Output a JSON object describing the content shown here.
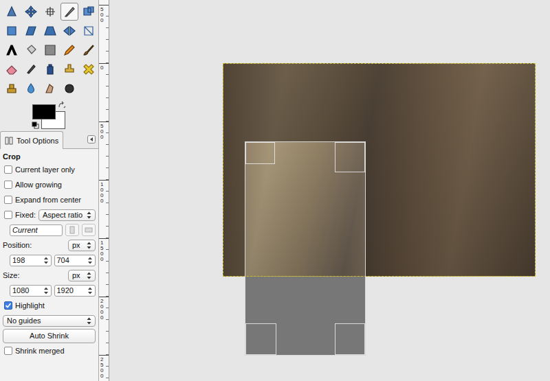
{
  "toolbox": {
    "tools": [
      {
        "selected": false
      },
      {
        "selected": false
      },
      {
        "selected": false
      },
      {
        "selected": true
      },
      {
        "selected": false
      },
      {
        "selected": false
      },
      {
        "selected": false
      },
      {
        "selected": false
      },
      {
        "selected": false
      },
      {
        "selected": false
      },
      {
        "selected": false
      },
      {
        "selected": false
      },
      {
        "selected": false
      },
      {
        "selected": false
      },
      {
        "selected": false
      },
      {
        "selected": false
      },
      {
        "selected": false
      },
      {
        "selected": false
      },
      {
        "selected": false
      },
      {
        "selected": false
      },
      {
        "selected": false
      },
      {
        "selected": false
      },
      {
        "selected": false
      },
      {
        "selected": false
      }
    ],
    "colors": {
      "foreground": "#000000",
      "background": "#ffffff"
    }
  },
  "tool_options": {
    "tab": "Tool Options",
    "title": "Crop",
    "checkboxes": [
      {
        "label": "Current layer only",
        "checked": false
      },
      {
        "label": "Allow growing",
        "checked": false
      },
      {
        "label": "Expand from center",
        "checked": false
      }
    ],
    "fixed": {
      "label": "Fixed:",
      "checked": false,
      "mode": "Aspect ratio",
      "value": "Current"
    },
    "position": {
      "label": "Position:",
      "unit": "px",
      "x": "198",
      "y": "704"
    },
    "size": {
      "label": "Size:",
      "unit": "px",
      "width": "1080",
      "height": "1920"
    },
    "highlight": {
      "label": "Highlight",
      "checked": true
    },
    "guides": "No guides",
    "auto_shrink": "Auto Shrink",
    "shrink_merged": {
      "label": "Shrink merged",
      "checked": false
    }
  },
  "ruler": {
    "labels": [
      "500",
      "0",
      "500",
      "1000",
      "1500",
      "2000",
      "2500"
    ]
  }
}
